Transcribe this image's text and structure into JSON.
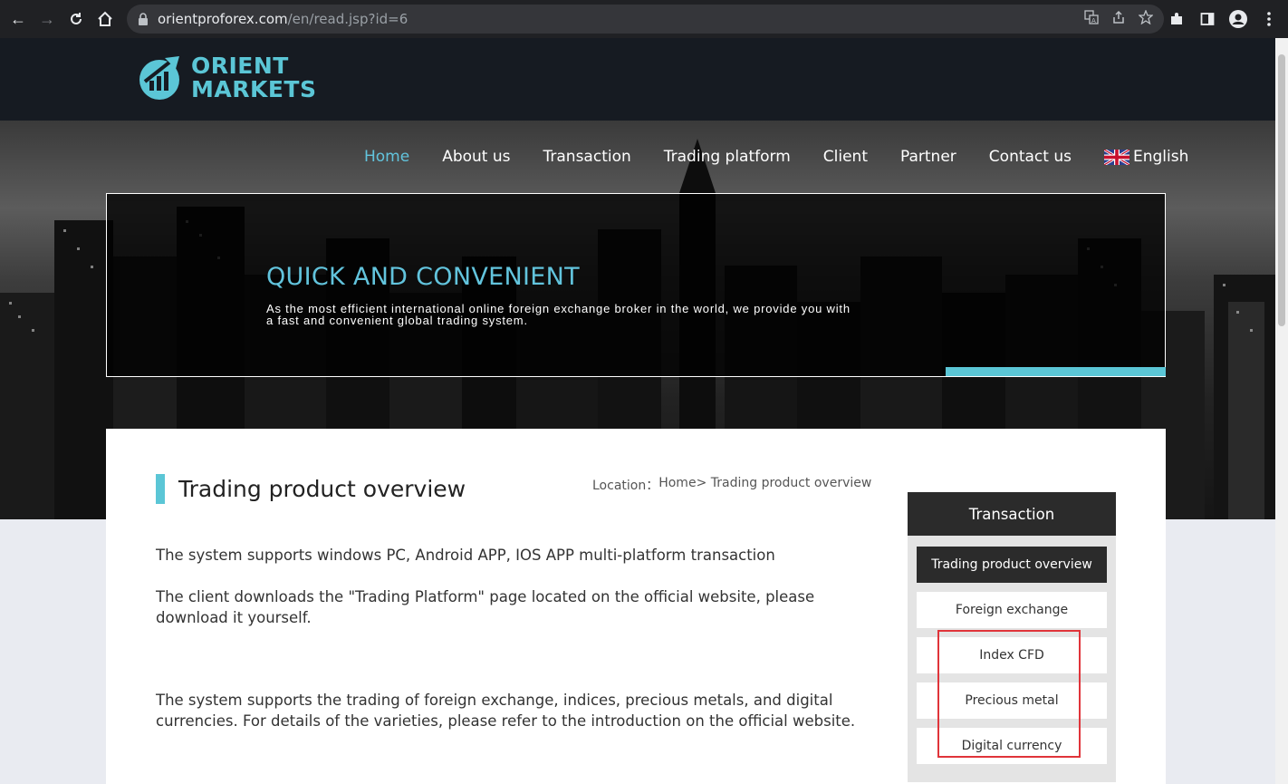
{
  "browser": {
    "url_host": "orientproforex.com",
    "url_path": "/en/read.jsp?id=6",
    "icons": [
      "back-icon",
      "forward-icon",
      "reload-icon",
      "home-icon",
      "lock-icon",
      "translate-icon",
      "share-icon",
      "star-icon",
      "puzzle-icon",
      "sidepanel-icon",
      "profile-icon",
      "menu-icon"
    ]
  },
  "brand": {
    "line1": "ORIENT",
    "line2": "MARKETS",
    "color": "#5bc6d6"
  },
  "nav": {
    "items": [
      "Home",
      "About us",
      "Transaction",
      "Trading platform",
      "Client",
      "Partner",
      "Contact us"
    ],
    "language": "English",
    "active_color": "#62c4dd"
  },
  "banner": {
    "title": "QUICK AND CONVENIENT",
    "desc_line1": "As the most efficient international online foreign exchange broker in the world, we provide you with",
    "desc_line2": "a fast and convenient global trading system."
  },
  "main": {
    "title": "Trading product overview",
    "breadcrumb": {
      "label": "Location：",
      "home": "Home",
      "sep": ">",
      "current": " Trading product overview"
    },
    "para1": "The system supports windows PC, Android APP, IOS APP multi-platform transaction",
    "para2": "The client downloads the \"Trading Platform\" page located on the official website, please download it yourself.",
    "para3": "The system supports the trading of foreign exchange, indices, precious metals, and digital currencies. For details of the varieties, please refer to the introduction on the official website."
  },
  "sidebar": {
    "heading": "Transaction",
    "items": [
      "Trading product overview",
      "Foreign exchange",
      "Index CFD",
      "Precious metal",
      "Digital currency"
    ],
    "highlight_color": "#e0343a"
  }
}
